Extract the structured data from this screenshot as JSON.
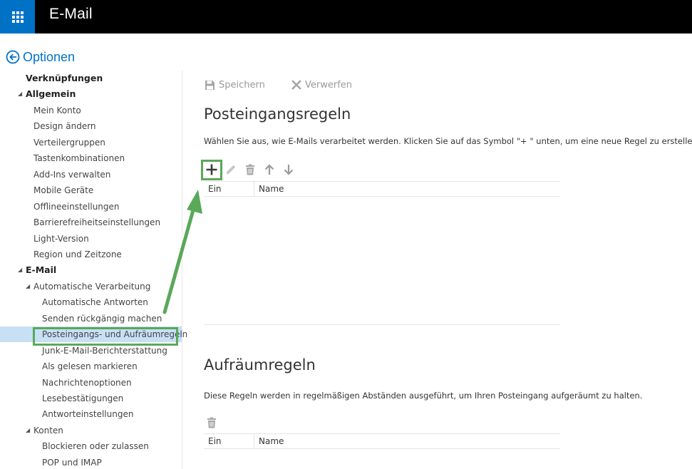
{
  "header": {
    "app_title": "E-Mail",
    "launcher_icon": "app-launcher-icon",
    "accent_color": "#0072c6"
  },
  "options": {
    "title": "Optionen",
    "back_icon": "back-arrow-circle-icon"
  },
  "nav": {
    "items": [
      {
        "label": "Verknüpfungen",
        "level": 0,
        "expander": false
      },
      {
        "label": "Allgemein",
        "level": 0,
        "expander": true
      },
      {
        "label": "Mein Konto",
        "level": 1,
        "expander": false
      },
      {
        "label": "Design ändern",
        "level": 1,
        "expander": false
      },
      {
        "label": "Verteilergruppen",
        "level": 1,
        "expander": false
      },
      {
        "label": "Tastenkombinationen",
        "level": 1,
        "expander": false
      },
      {
        "label": "Add-Ins verwalten",
        "level": 1,
        "expander": false
      },
      {
        "label": "Mobile Geräte",
        "level": 1,
        "expander": false
      },
      {
        "label": "Offlineeinstellungen",
        "level": 1,
        "expander": false
      },
      {
        "label": "Barrierefreiheitseinstellungen",
        "level": 1,
        "expander": false
      },
      {
        "label": "Light-Version",
        "level": 1,
        "expander": false
      },
      {
        "label": "Region und Zeitzone",
        "level": 1,
        "expander": false
      },
      {
        "label": "E-Mail",
        "level": 0,
        "expander": true
      },
      {
        "label": "Automatische Verarbeitung",
        "level": 1,
        "expander": true
      },
      {
        "label": "Automatische Antworten",
        "level": 2,
        "expander": false
      },
      {
        "label": "Senden rückgängig machen",
        "level": 2,
        "expander": false
      },
      {
        "label": "Posteingangs- und Aufräumregeln",
        "level": 2,
        "expander": false,
        "selected": true
      },
      {
        "label": "Junk-E-Mail-Berichterstattung",
        "level": 2,
        "expander": false
      },
      {
        "label": "Als gelesen markieren",
        "level": 2,
        "expander": false
      },
      {
        "label": "Nachrichtenoptionen",
        "level": 2,
        "expander": false
      },
      {
        "label": "Lesebestätigungen",
        "level": 2,
        "expander": false
      },
      {
        "label": "Antworteinstellungen",
        "level": 2,
        "expander": false
      },
      {
        "label": "Konten",
        "level": 1,
        "expander": true
      },
      {
        "label": "Blockieren oder zulassen",
        "level": 2,
        "expander": false
      },
      {
        "label": "POP und IMAP",
        "level": 2,
        "expander": false
      }
    ],
    "selected_bg": "#c7e0f4",
    "highlight_color": "#5aa85a"
  },
  "toolbar": {
    "save_label": "Speichern",
    "discard_label": "Verwerfen",
    "save_icon": "floppy-disk-icon",
    "discard_icon": "x-icon"
  },
  "inbox_rules": {
    "title": "Posteingangsregeln",
    "description": "Wählen Sie aus, wie E-Mails verarbeitet werden. Klicken Sie auf das Symbol \"+ \" unten, um eine neue Regel zu erstellen.",
    "actions": [
      "add-icon",
      "edit-pencil-icon",
      "delete-trash-icon",
      "move-up-arrow-icon",
      "move-down-arrow-icon"
    ],
    "columns": [
      "Ein",
      "Name"
    ]
  },
  "sweep_rules": {
    "title": "Aufräumregeln",
    "description": "Diese Regeln werden in regelmäßigen Abständen ausgeführt, um Ihren Posteingang aufgeräumt zu halten.",
    "actions": [
      "delete-trash-icon"
    ],
    "columns": [
      "Ein",
      "Name"
    ]
  },
  "annotation": {
    "arrow_color": "#5aa85a",
    "arrow_icon": "annotation-arrow-icon"
  }
}
